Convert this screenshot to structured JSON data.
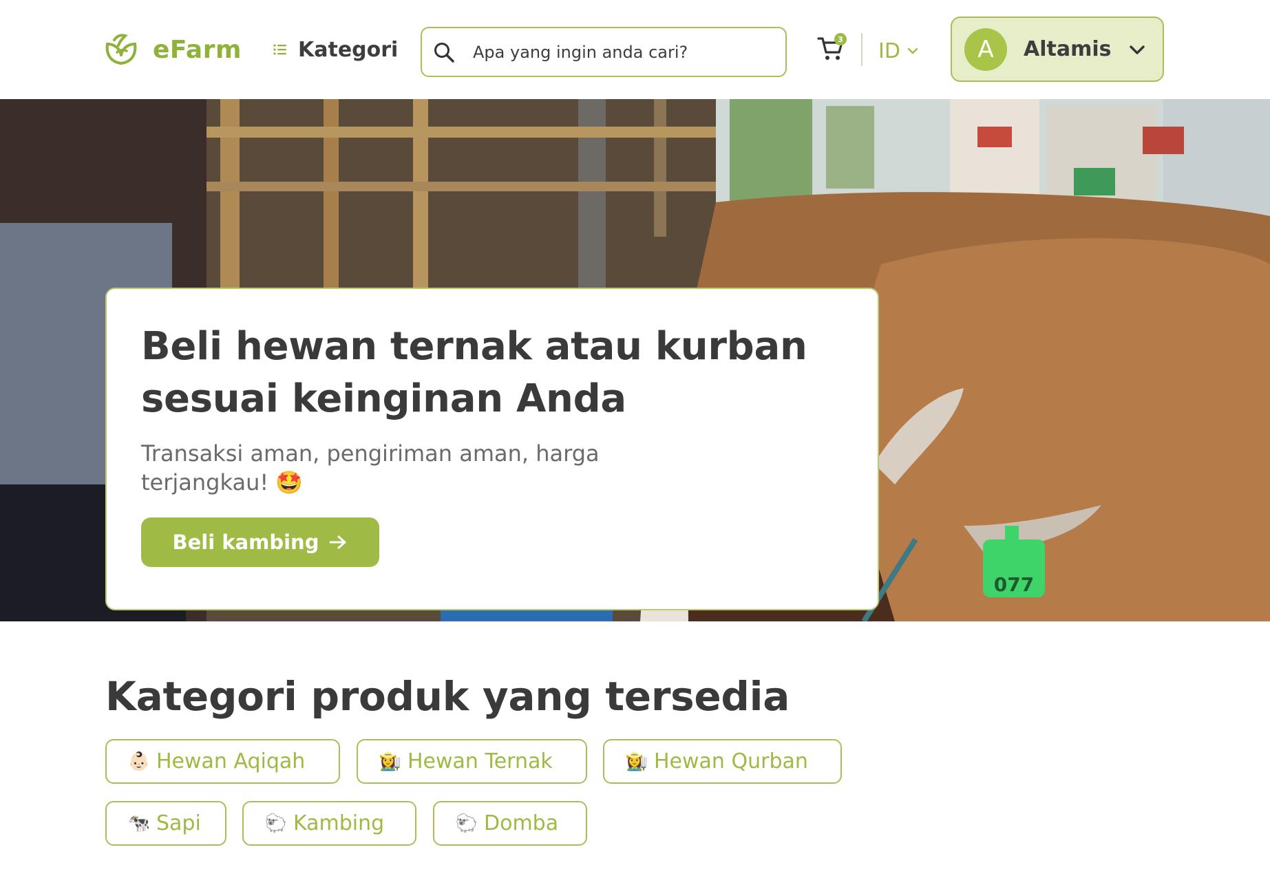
{
  "header": {
    "logo_text": "eFarm",
    "kategori_label": "Kategori",
    "search_placeholder": "Apa yang ingin anda cari?",
    "cart_count": "3",
    "language": "ID",
    "user": {
      "initial": "A",
      "name": "Altamis"
    }
  },
  "hero": {
    "title": "Beli hewan ternak atau kurban sesuai keinginan Anda",
    "subtitle": "Transaksi aman, pengiriman aman, harga terjangkau! 🤩",
    "cta_label": "Beli kambing",
    "cta_arrow": "→"
  },
  "categories": {
    "title": "Kategori produk yang tersedia",
    "items": [
      {
        "emoji": "👶🏻",
        "label": "Hewan Aqiqah"
      },
      {
        "emoji": "👩‍🌾",
        "label": "Hewan Ternak"
      },
      {
        "emoji": "👩‍🌾",
        "label": "Hewan Qurban"
      },
      {
        "emoji": "🐄",
        "label": "Sapi"
      },
      {
        "emoji": "🐑",
        "label": "Kambing"
      },
      {
        "emoji": "🐑",
        "label": "Domba"
      }
    ]
  },
  "colors": {
    "brand_green": "#9dba43",
    "brand_green_light": "#e6edc8",
    "text_dark": "#3a3a3a",
    "text_muted": "#6a6a6a"
  },
  "icons": [
    "leaf-logo-icon",
    "list-icon",
    "search-icon",
    "cart-icon",
    "chevron-down-icon",
    "arrow-right-icon"
  ]
}
